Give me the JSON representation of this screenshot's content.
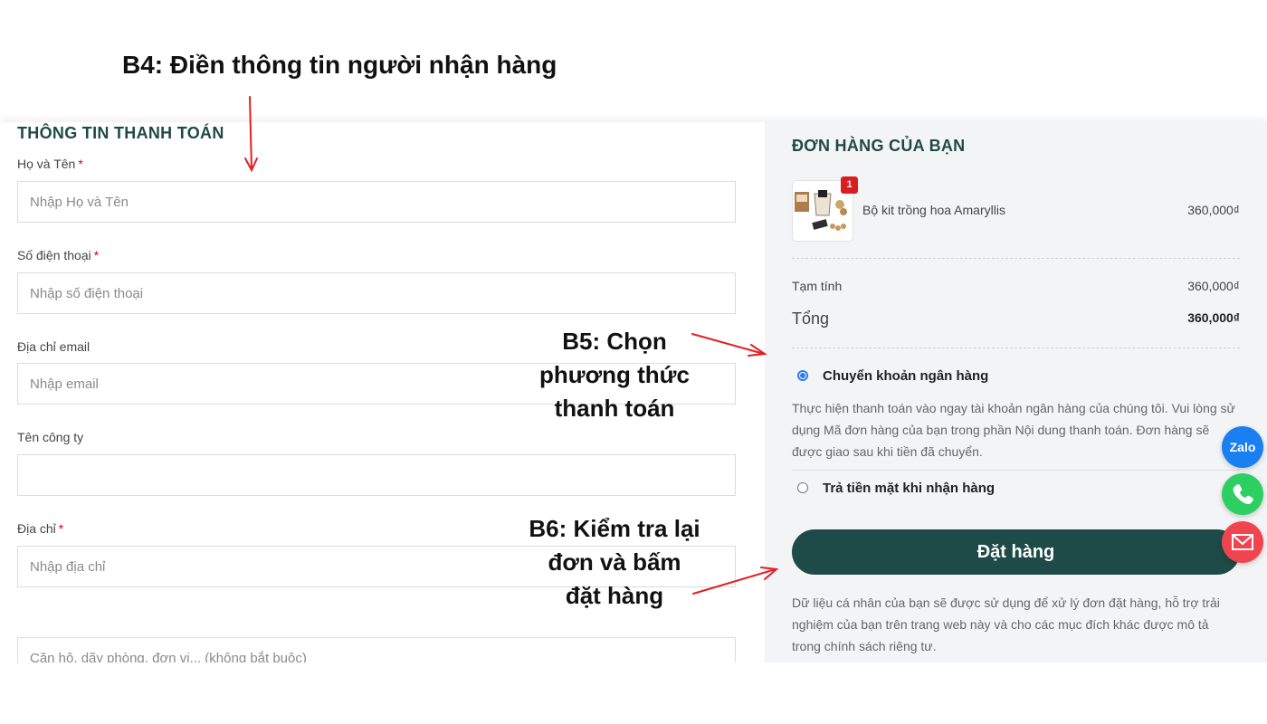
{
  "annotations": {
    "step4": "B4: Điền thông tin người nhận hàng",
    "step5_lines": [
      "B5: Chọn",
      "phương thức",
      "thanh toán"
    ],
    "step6_lines": [
      "B6: Kiểm tra lại",
      "đơn và bấm",
      "đặt hàng"
    ]
  },
  "billing": {
    "title": "THÔNG TIN THANH TOÁN",
    "required_mark": "*",
    "fields": {
      "name": {
        "label": "Họ và Tên",
        "placeholder": "Nhập Họ và Tên"
      },
      "phone": {
        "label": "Số điện thoại",
        "placeholder": "Nhập số điện thoại"
      },
      "email": {
        "label": "Địa chỉ email",
        "placeholder": "Nhập email"
      },
      "company": {
        "label": "Tên công ty",
        "placeholder": ""
      },
      "address": {
        "label": "Địa chỉ",
        "placeholder": "Nhập địa chỉ"
      },
      "address2": {
        "placeholder": "Căn hộ, dãy phòng, đơn vị,.. (không bắt buộc)"
      }
    }
  },
  "order": {
    "title": "ĐƠN HÀNG CỦA BẠN",
    "item": {
      "name": "Bộ kit trồng hoa Amaryllis",
      "qty": "1",
      "price": "360,000₫"
    },
    "subtotal_label": "Tạm tính",
    "subtotal": "360,000₫",
    "total_label": "Tổng",
    "total": "360,000₫",
    "payment": {
      "bank_label": "Chuyển khoản ngân hàng",
      "bank_desc": "Thực hiện thanh toán vào ngay tài khoản ngân hàng của chúng tôi. Vui lòng sử dụng Mã đơn hàng của bạn trong phần Nội dung thanh toán. Đơn hàng sẽ được giao sau khi tiền đã chuyển.",
      "cod_label": "Trả tiền mặt khi nhận hàng"
    },
    "button_label": "Đặt hàng",
    "privacy": "Dữ liệu cá nhân của bạn sẽ được sử dụng để xử lý đơn đặt hàng, hỗ trợ trải nghiệm của bạn trên trang web này và cho các mục đích khác được mô tả trong chính sách riêng tư."
  },
  "contact": {
    "zalo_label": "Zalo"
  },
  "colors": {
    "accent": "#1e4a47",
    "arrow": "#e31e24",
    "required": "#d0021b",
    "radio": "#2b7de9"
  }
}
